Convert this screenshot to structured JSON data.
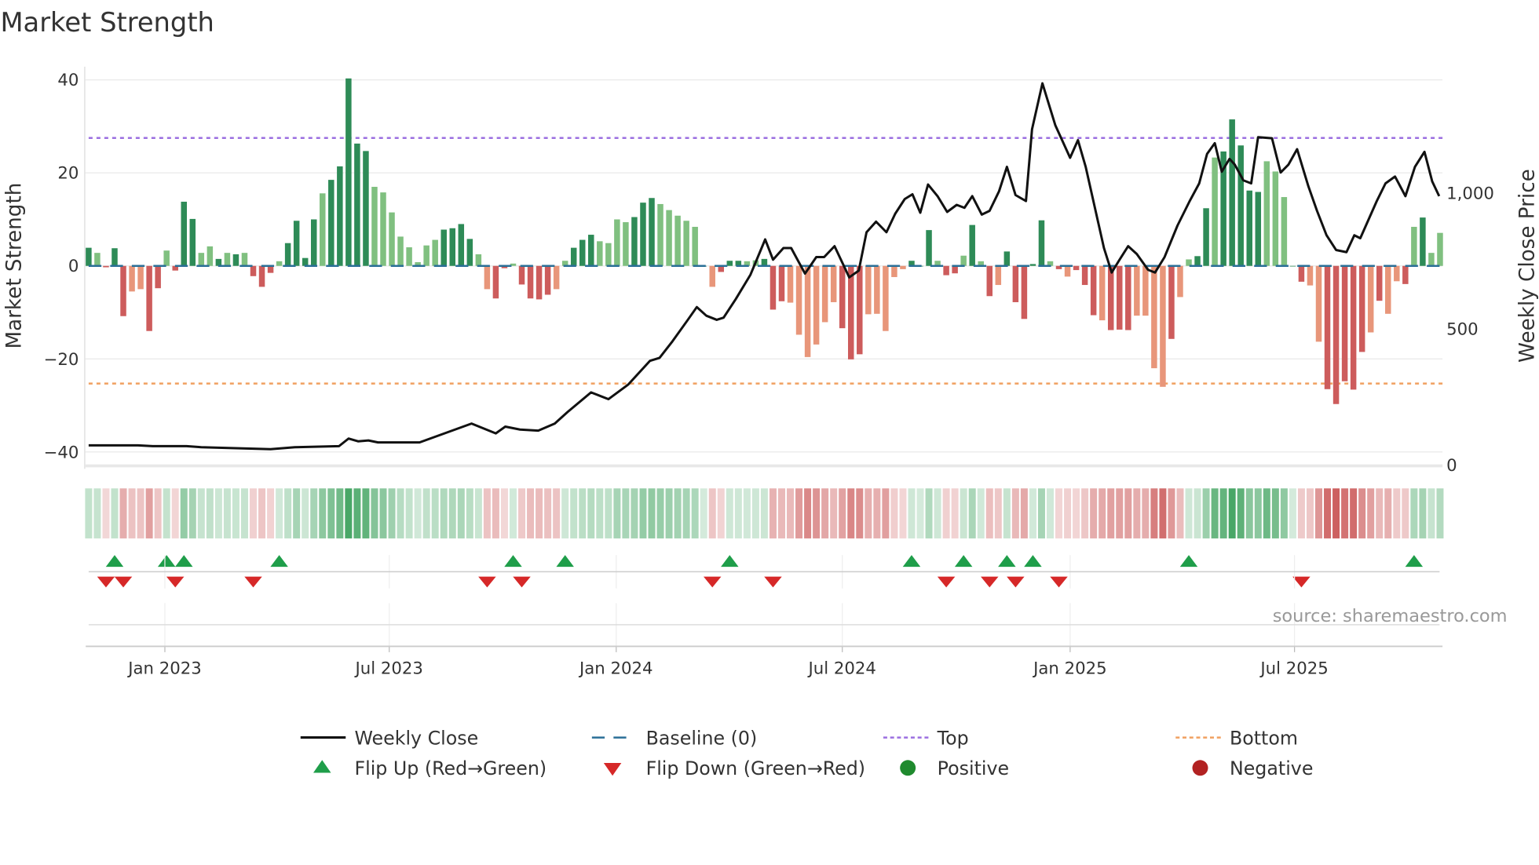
{
  "chart_data": {
    "type": "bar",
    "title": "Market Strength",
    "ylabel": "Market Strength",
    "y2label": "Weekly Close Price",
    "ylim": [
      -43.2,
      40.3
    ],
    "y2lim": [
      -7,
      1422
    ],
    "yticks": [
      40,
      20,
      0,
      -20,
      -40
    ],
    "yticklabels": [
      "40",
      "20",
      "0",
      "−20",
      "−40"
    ],
    "y2ticks": [
      0,
      500,
      1000
    ],
    "y2ticklabels": [
      "0",
      "500",
      "1,000"
    ],
    "x_unit": "week index",
    "xticks": [
      {
        "label": "Jan 2023",
        "week": 8.8
      },
      {
        "label": "Jul 2023",
        "week": 34.7
      },
      {
        "label": "Jan 2024",
        "week": 60.9
      },
      {
        "label": "Jul 2024",
        "week": 87.0
      },
      {
        "label": "Jan 2025",
        "week": 113.3
      },
      {
        "label": "Jul 2025",
        "week": 139.2
      }
    ],
    "top_level": 27.5,
    "bottom_level": -25.3,
    "baseline": 0,
    "strength": [
      3.9,
      2.8,
      -0.3,
      3.8,
      -10.8,
      -5.5,
      -5,
      -14,
      -4.8,
      3.3,
      -1,
      13.8,
      10.1,
      2.8,
      4.2,
      1.5,
      2.8,
      2.5,
      2.8,
      -2.2,
      -4.5,
      -1.5,
      1,
      4.9,
      9.7,
      1.7,
      10,
      15.6,
      18.5,
      21.4,
      40.3,
      26.3,
      24.7,
      17,
      15.8,
      11.5,
      6.3,
      4,
      0.8,
      4.4,
      5.6,
      7.8,
      8.1,
      9,
      5.8,
      2.5,
      -5,
      -7,
      -0.5,
      0.5,
      -4,
      -7,
      -7.2,
      -6.2,
      -5,
      1.1,
      3.9,
      5.6,
      6.7,
      5.3,
      4.9,
      10,
      9.4,
      10.5,
      13.6,
      14.6,
      13.3,
      12,
      10.8,
      9.7,
      8.4,
      0,
      -4.5,
      -1.3,
      1.1,
      1.1,
      1,
      1.2,
      1.5,
      -9.4,
      -7.6,
      -7.9,
      -14.8,
      -19.6,
      -16.9,
      -12.1,
      -7.8,
      -13.4,
      -20.1,
      -19,
      -10.4,
      -10.3,
      -14,
      -2.4,
      -0.7,
      1.1,
      0,
      7.7,
      1.1,
      -2,
      -1.6,
      2.2,
      8.8,
      1,
      -6.5,
      -4.1,
      3.1,
      -7.8,
      -11.4,
      0.4,
      9.8,
      1,
      -0.7,
      -2.3,
      -0.9,
      -4.1,
      -10.6,
      -11.7,
      -13.8,
      -13.7,
      -13.8,
      -10.7,
      -10.7,
      -22,
      -26,
      -15.7,
      -6.7,
      1.4,
      2.1,
      12.4,
      23.3,
      24.6,
      31.5,
      25.9,
      16.2,
      15.9,
      22.5,
      20.3,
      14.8,
      0,
      -3.4,
      -4.2,
      -16.3,
      -26.5,
      -29.7,
      -24.8,
      -26.6,
      -18.5,
      -14.3,
      -7.5,
      -10.3,
      -3.3,
      -3.9,
      8.4,
      10.4,
      2.8,
      7.1
    ],
    "shade": "dldddllddldddlldldldddlddddldddddllllllllddddllddlddddlldddlllldddllllldldddlldddlllllldddllllldddlddldldldddddldldddldddlllldllddldddddlllddlldddddldlldldlldldddd",
    "weekly_close": [
      [
        0,
        72
      ],
      [
        5.7,
        72
      ],
      [
        7.4,
        69
      ],
      [
        11.3,
        69
      ],
      [
        13,
        65
      ],
      [
        21,
        58
      ],
      [
        23.8,
        65
      ],
      [
        28.9,
        69
      ],
      [
        30,
        97
      ],
      [
        31.1,
        87
      ],
      [
        32.3,
        90
      ],
      [
        33.4,
        83
      ],
      [
        38.2,
        83
      ],
      [
        44.2,
        152
      ],
      [
        47,
        116
      ],
      [
        48.1,
        141
      ],
      [
        49.8,
        130
      ],
      [
        51.9,
        126
      ],
      [
        53.8,
        152
      ],
      [
        55.3,
        195
      ],
      [
        58,
        267
      ],
      [
        60,
        242
      ],
      [
        62.3,
        296
      ],
      [
        64.8,
        383
      ],
      [
        65.9,
        394
      ],
      [
        67.4,
        455
      ],
      [
        69.1,
        531
      ],
      [
        70.2,
        581
      ],
      [
        71.3,
        549
      ],
      [
        72.5,
        534
      ],
      [
        73.3,
        542
      ],
      [
        74.7,
        610
      ],
      [
        76.4,
        700
      ],
      [
        78.1,
        830
      ],
      [
        79,
        755
      ],
      [
        80.2,
        798
      ],
      [
        81.1,
        798
      ],
      [
        82.7,
        704
      ],
      [
        84,
        765
      ],
      [
        84.9,
        765
      ],
      [
        86.1,
        805
      ],
      [
        87.8,
        690
      ],
      [
        88.9,
        715
      ],
      [
        89.8,
        856
      ],
      [
        90.9,
        895
      ],
      [
        92.1,
        856
      ],
      [
        93.1,
        924
      ],
      [
        94.2,
        978
      ],
      [
        95.1,
        996
      ],
      [
        96,
        928
      ],
      [
        96.9,
        1032
      ],
      [
        98,
        989
      ],
      [
        99.1,
        931
      ],
      [
        100.2,
        957
      ],
      [
        101.1,
        946
      ],
      [
        102,
        989
      ],
      [
        103.1,
        921
      ],
      [
        104,
        935
      ],
      [
        105.1,
        1007
      ],
      [
        106,
        1097
      ],
      [
        107,
        993
      ],
      [
        108.2,
        971
      ],
      [
        108.9,
        1235
      ],
      [
        110.1,
        1404
      ],
      [
        111.6,
        1249
      ],
      [
        113.3,
        1130
      ],
      [
        114.2,
        1195
      ],
      [
        115.1,
        1097
      ],
      [
        117.2,
        798
      ],
      [
        118.1,
        708
      ],
      [
        119,
        755
      ],
      [
        120,
        805
      ],
      [
        121,
        776
      ],
      [
        122.3,
        718
      ],
      [
        123.1,
        708
      ],
      [
        124.2,
        765
      ],
      [
        125.7,
        881
      ],
      [
        127.1,
        971
      ],
      [
        128.2,
        1036
      ],
      [
        129.1,
        1144
      ],
      [
        130,
        1184
      ],
      [
        130.8,
        1079
      ],
      [
        131.7,
        1126
      ],
      [
        132.3,
        1105
      ],
      [
        133.3,
        1047
      ],
      [
        134.2,
        1036
      ],
      [
        135,
        1206
      ],
      [
        136.6,
        1202
      ],
      [
        137.6,
        1076
      ],
      [
        138.5,
        1105
      ],
      [
        139.5,
        1162
      ],
      [
        140.8,
        1025
      ],
      [
        141.8,
        935
      ],
      [
        142.9,
        845
      ],
      [
        144,
        791
      ],
      [
        145.2,
        783
      ],
      [
        146.1,
        845
      ],
      [
        146.8,
        834
      ],
      [
        148.7,
        971
      ],
      [
        149.7,
        1036
      ],
      [
        150.8,
        1061
      ],
      [
        152,
        989
      ],
      [
        153.1,
        1097
      ],
      [
        154.2,
        1152
      ],
      [
        155.1,
        1043
      ],
      [
        155.9,
        989
      ]
    ],
    "flip_up_weeks": [
      3,
      9,
      11,
      22,
      49,
      55,
      74,
      95,
      101,
      106,
      109,
      127,
      153
    ],
    "flip_down_weeks": [
      2,
      4,
      10,
      19,
      46,
      50,
      72,
      79,
      99,
      104,
      107,
      112,
      140
    ],
    "legend": {
      "placement": "bottom",
      "items": [
        {
          "label": "Weekly Close",
          "kind": "line",
          "color": "#111111"
        },
        {
          "label": "Baseline (0)",
          "kind": "dashed",
          "color": "#2a6f97"
        },
        {
          "label": "Top",
          "kind": "dotted",
          "color": "#9b6fe0"
        },
        {
          "label": "Bottom",
          "kind": "dotted",
          "color": "#f0a060"
        },
        {
          "label": "Flip Up (Red→Green)",
          "kind": "triangle-up",
          "color": "#1f9e4a"
        },
        {
          "label": "Flip Down (Green→Red)",
          "kind": "triangle-down",
          "color": "#d62828"
        },
        {
          "label": "Positive",
          "kind": "circle",
          "color": "#1f8a2e"
        },
        {
          "label": "Negative",
          "kind": "circle",
          "color": "#b22222"
        }
      ]
    },
    "colors": {
      "pos_dark": "#2e8b57",
      "pos_light": "#80c080",
      "neg_dark": "#cd5c5c",
      "neg_light": "#e8967a"
    },
    "source": "source: sharemaestro.com"
  }
}
